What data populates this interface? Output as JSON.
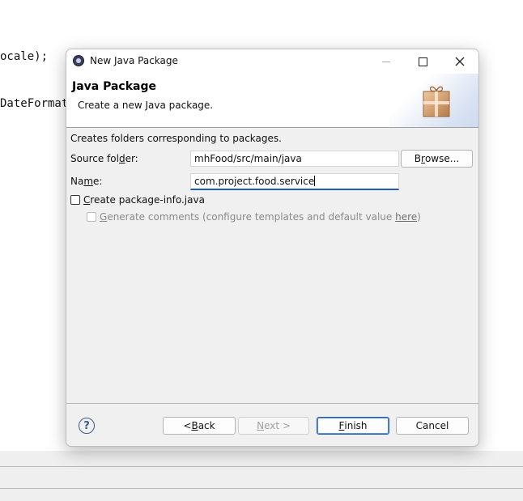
{
  "editor": {
    "line1": "ocale);",
    "line2": "DateFormat"
  },
  "dialog": {
    "title": "New Java Package",
    "app_icon": "eclipse-icon",
    "header": {
      "title": "Java Package",
      "description": "Create a new Java package.",
      "icon": "package-icon"
    },
    "intro": "Creates folders corresponding to packages.",
    "source_folder": {
      "label_pre": "Source fol",
      "label_mnemonic": "d",
      "label_post": "er:",
      "value": "mhFood/src/main/java",
      "browse_pre": "B",
      "browse_mnemonic": "r",
      "browse_post": "owse..."
    },
    "name": {
      "label_pre": "Na",
      "label_mnemonic": "m",
      "label_post": "e:",
      "value": "com.project.food.service"
    },
    "create_package_info": {
      "mnemonic": "C",
      "label_rest": "reate package-info.java",
      "checked": false
    },
    "generate_comments": {
      "mnemonic": "G",
      "label_rest": "enerate comments",
      "suffix_pre": " (configure templates and default value ",
      "link": "here",
      "suffix_post": ")",
      "checked": false,
      "enabled": false
    },
    "buttons": {
      "back_pre": "< ",
      "back_mnemonic": "B",
      "back_post": "ack",
      "next_mnemonic": "N",
      "next_post": "ext >",
      "finish_mnemonic": "F",
      "finish_post": "inish",
      "cancel": "Cancel"
    },
    "help_icon": "help-icon",
    "help_glyph": "?"
  }
}
